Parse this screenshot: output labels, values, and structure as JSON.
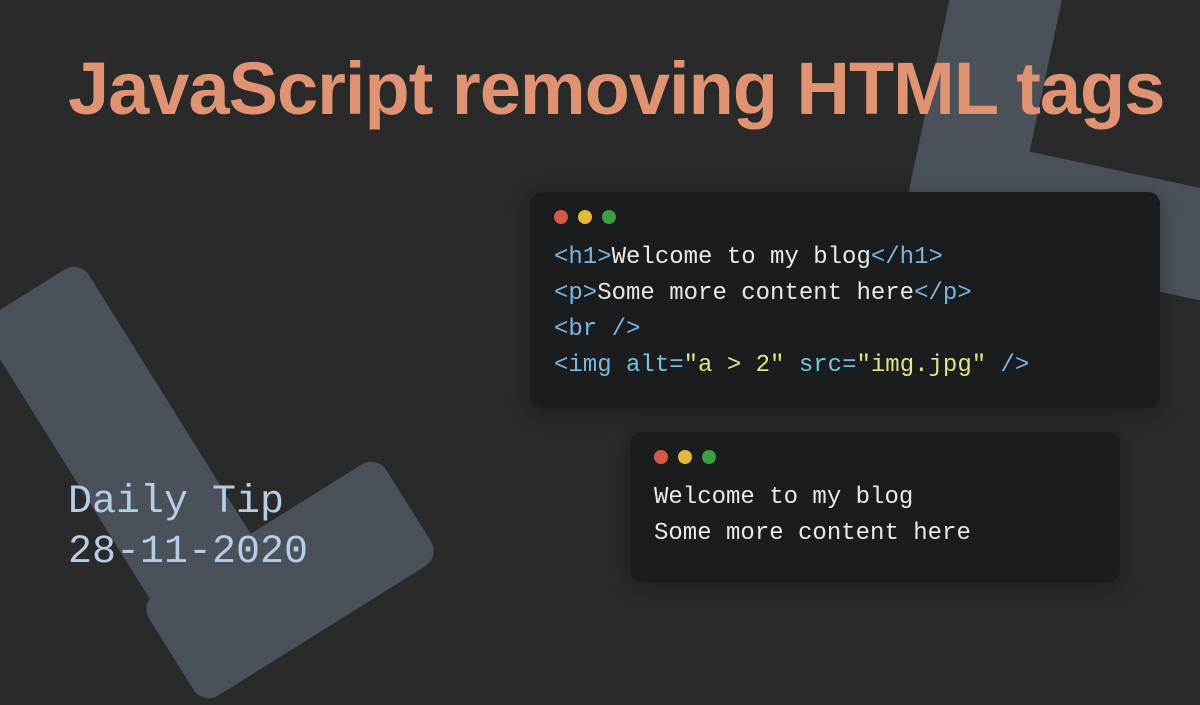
{
  "title": "JavaScript removing HTML tags",
  "subtitle_label": "Daily Tip",
  "subtitle_date": "28-11-2020",
  "code_input": {
    "lines": [
      {
        "parts": [
          {
            "cls": "tag",
            "t": "<h1>"
          },
          {
            "cls": "txt",
            "t": "Welcome to my blog"
          },
          {
            "cls": "tag",
            "t": "</h1>"
          }
        ]
      },
      {
        "parts": [
          {
            "cls": "tag",
            "t": "<p>"
          },
          {
            "cls": "txt",
            "t": "Some more content here"
          },
          {
            "cls": "tag",
            "t": "</p>"
          }
        ]
      },
      {
        "parts": [
          {
            "cls": "tag",
            "t": "<br />"
          }
        ]
      },
      {
        "parts": [
          {
            "cls": "tag",
            "t": "<img "
          },
          {
            "cls": "attr",
            "t": "alt"
          },
          {
            "cls": "tag",
            "t": "="
          },
          {
            "cls": "str",
            "t": "\"a > 2\""
          },
          {
            "cls": "tag",
            "t": " "
          },
          {
            "cls": "attr",
            "t": "src"
          },
          {
            "cls": "tag",
            "t": "="
          },
          {
            "cls": "str",
            "t": "\"img.jpg\""
          },
          {
            "cls": "tag",
            "t": " />"
          }
        ]
      }
    ]
  },
  "code_output": {
    "lines": [
      {
        "parts": [
          {
            "cls": "txt",
            "t": "Welcome to my blog"
          }
        ]
      },
      {
        "parts": [
          {
            "cls": "txt",
            "t": "Some more content here"
          }
        ]
      }
    ]
  }
}
